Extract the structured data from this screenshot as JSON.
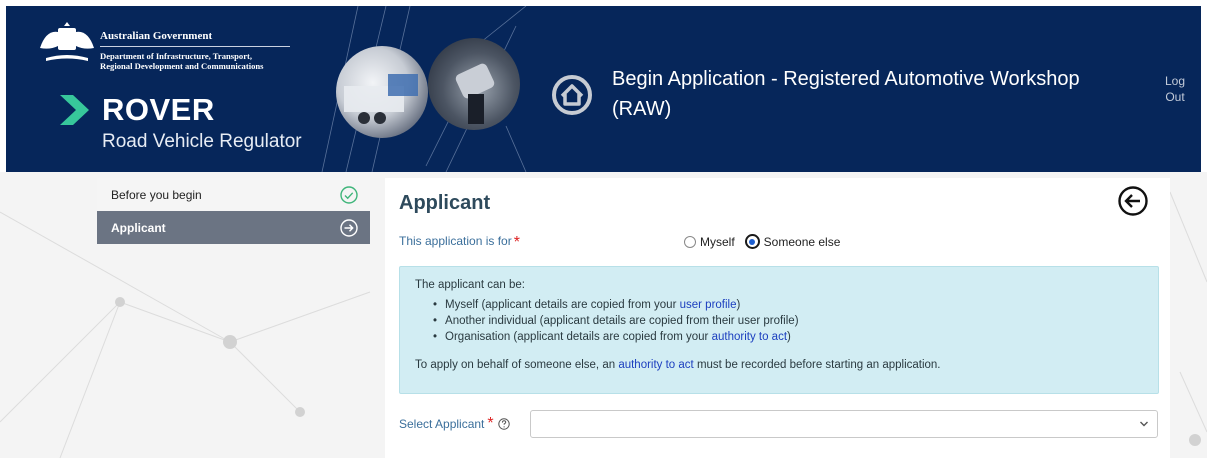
{
  "header": {
    "gov_title": "Australian Government",
    "dept_line1": "Department of Infrastructure, Transport,",
    "dept_line2": "Regional Development and Communications",
    "brand": "ROVER",
    "brand_sub": "Road Vehicle Regulator",
    "page_title": "Begin Application - Registered Automotive Workshop (RAW)",
    "logout_line1": "Log",
    "logout_line2": "Out",
    "home_icon": "home-icon",
    "brand_color": "#06265a"
  },
  "sidebar": {
    "items": [
      {
        "label": "Before you begin",
        "state": "done",
        "icon": "check-circle-icon"
      },
      {
        "label": "Applicant",
        "state": "active",
        "icon": "arrow-right-circle-icon"
      }
    ]
  },
  "main": {
    "section_title": "Applicant",
    "back_icon": "arrow-left-circle-icon",
    "application_for": {
      "label": "This application is for",
      "required": "*",
      "options": [
        "Myself",
        "Someone else"
      ],
      "selected": "Someone else"
    },
    "info": {
      "intro": "The applicant can be:",
      "bullets": [
        {
          "before": "Myself (applicant details are copied from your ",
          "link": "user profile",
          "after": ")"
        },
        {
          "before": "Another individual (applicant details are copied from their user profile)",
          "link": "",
          "after": ""
        },
        {
          "before": "Organisation (applicant details are copied from your ",
          "link": "authority to act",
          "after": ")"
        }
      ],
      "footer_before": "To apply on behalf of someone else, an ",
      "footer_link": "authority to act",
      "footer_after": " must be recorded before starting an application."
    },
    "select_applicant": {
      "label": "Select Applicant",
      "required": "*",
      "value": ""
    }
  }
}
